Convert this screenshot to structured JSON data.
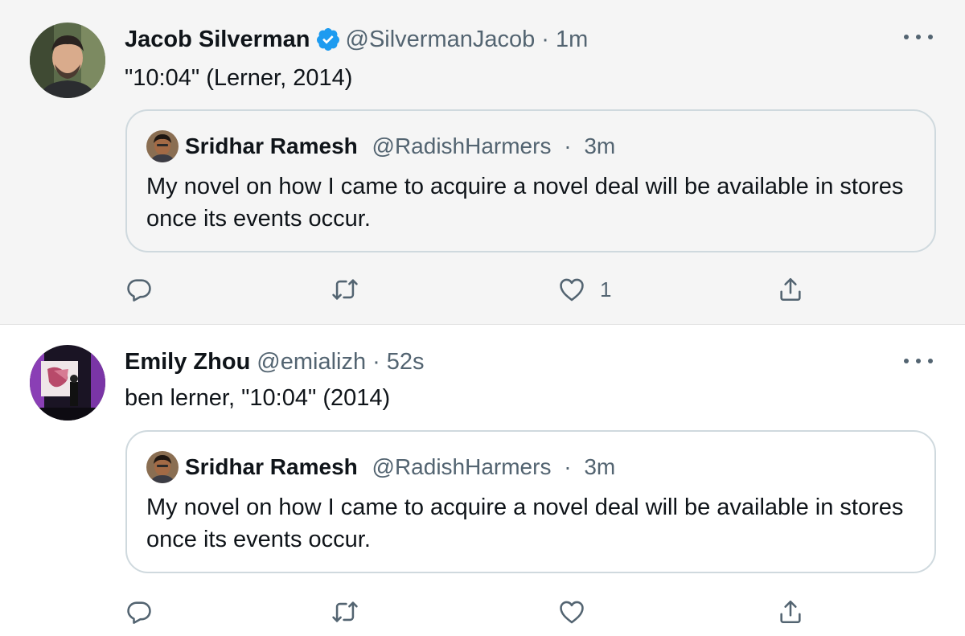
{
  "tweets": [
    {
      "author": {
        "name": "Jacob Silverman",
        "handle": "@SilvermanJacob",
        "time": "1m",
        "verified": true
      },
      "text": "\"10:04\" (Lerner, 2014)",
      "quote": {
        "author": {
          "name": "Sridhar Ramesh",
          "handle": "@RadishHarmers",
          "time": "3m"
        },
        "text": "My novel on how I came to acquire a novel deal will be available in stores once its events occur."
      },
      "actions": {
        "reply_count": "",
        "retweet_count": "",
        "like_count": "1"
      }
    },
    {
      "author": {
        "name": "Emily Zhou",
        "handle": "@emializh",
        "time": "52s",
        "verified": false
      },
      "text": "ben lerner, \"10:04\" (2014)",
      "quote": {
        "author": {
          "name": "Sridhar Ramesh",
          "handle": "@RadishHarmers",
          "time": "3m"
        },
        "text": "My novel on how I came to acquire a novel deal will be available in stores once its events occur."
      },
      "actions": {
        "reply_count": "",
        "retweet_count": "",
        "like_count": ""
      }
    }
  ],
  "ui": {
    "separator": "·"
  },
  "icons": [
    "verified-badge-icon",
    "more-icon",
    "reply-icon",
    "retweet-icon",
    "like-icon",
    "share-icon"
  ],
  "colors": {
    "verified": "#1d9bf0",
    "secondary_text": "#536471",
    "quote_border": "#cfd9de",
    "highlight_bg": "#f5f5f5"
  }
}
